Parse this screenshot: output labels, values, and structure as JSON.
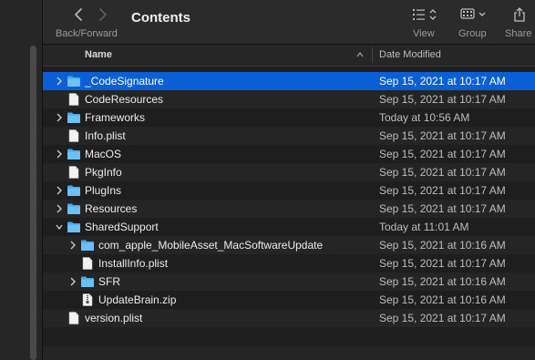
{
  "toolbar": {
    "nav_label": "Back/Forward",
    "title": "Contents",
    "view_label": "View",
    "group_label": "Group",
    "share_label": "Share"
  },
  "columns": {
    "name": "Name",
    "date_modified": "Date Modified"
  },
  "rows": [
    {
      "name": "_CodeSignature",
      "date": "Sep 15, 2021 at 10:17 AM",
      "kind": "folder",
      "depth": 0,
      "expandable": true,
      "expanded": false,
      "selected": true
    },
    {
      "name": "CodeResources",
      "date": "Sep 15, 2021 at 10:17 AM",
      "kind": "file",
      "depth": 0,
      "expandable": false,
      "expanded": false,
      "selected": false
    },
    {
      "name": "Frameworks",
      "date": "Today at 10:56 AM",
      "kind": "folder",
      "depth": 0,
      "expandable": true,
      "expanded": false,
      "selected": false
    },
    {
      "name": "Info.plist",
      "date": "Sep 15, 2021 at 10:17 AM",
      "kind": "file",
      "depth": 0,
      "expandable": false,
      "expanded": false,
      "selected": false
    },
    {
      "name": "MacOS",
      "date": "Sep 15, 2021 at 10:17 AM",
      "kind": "folder",
      "depth": 0,
      "expandable": true,
      "expanded": false,
      "selected": false
    },
    {
      "name": "PkgInfo",
      "date": "Sep 15, 2021 at 10:17 AM",
      "kind": "file",
      "depth": 0,
      "expandable": false,
      "expanded": false,
      "selected": false
    },
    {
      "name": "PlugIns",
      "date": "Sep 15, 2021 at 10:17 AM",
      "kind": "folder",
      "depth": 0,
      "expandable": true,
      "expanded": false,
      "selected": false
    },
    {
      "name": "Resources",
      "date": "Sep 15, 2021 at 10:17 AM",
      "kind": "folder",
      "depth": 0,
      "expandable": true,
      "expanded": false,
      "selected": false
    },
    {
      "name": "SharedSupport",
      "date": "Today at 11:01 AM",
      "kind": "folder",
      "depth": 0,
      "expandable": true,
      "expanded": true,
      "selected": false
    },
    {
      "name": "com_apple_MobileAsset_MacSoftwareUpdate",
      "date": "Sep 15, 2021 at 10:16 AM",
      "kind": "folder",
      "depth": 1,
      "expandable": true,
      "expanded": false,
      "selected": false
    },
    {
      "name": "InstallInfo.plist",
      "date": "Sep 15, 2021 at 10:17 AM",
      "kind": "file",
      "depth": 1,
      "expandable": false,
      "expanded": false,
      "selected": false
    },
    {
      "name": "SFR",
      "date": "Sep 15, 2021 at 10:16 AM",
      "kind": "folder",
      "depth": 1,
      "expandable": true,
      "expanded": false,
      "selected": false
    },
    {
      "name": "UpdateBrain.zip",
      "date": "Sep 15, 2021 at 10:16 AM",
      "kind": "zip",
      "depth": 1,
      "expandable": false,
      "expanded": false,
      "selected": false
    },
    {
      "name": "version.plist",
      "date": "Sep 15, 2021 at 10:17 AM",
      "kind": "file",
      "depth": 0,
      "expandable": false,
      "expanded": false,
      "selected": false
    }
  ],
  "colors": {
    "selection": "#0a5fd7",
    "folder": "#4aa8e8"
  }
}
